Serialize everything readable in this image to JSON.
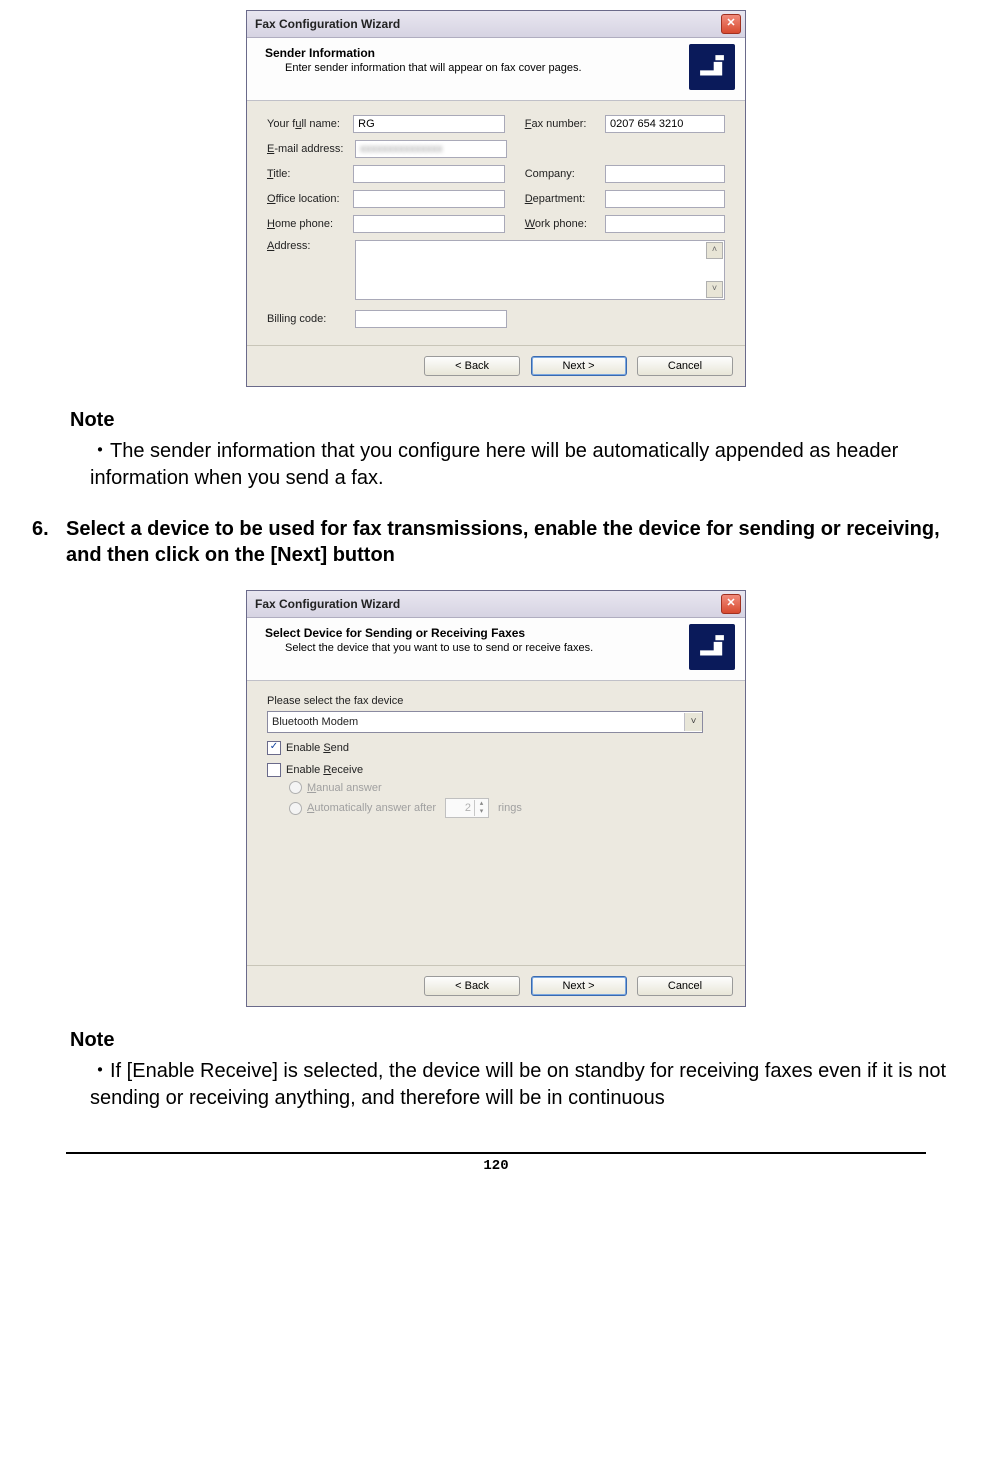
{
  "dialog1": {
    "title": "Fax Configuration Wizard",
    "banner_title": "Sender Information",
    "banner_sub": "Enter sender information that will appear on fax cover pages.",
    "fields": {
      "full_name_label": "Your full name:",
      "full_name_value": "RG",
      "fax_label": "Fax number:",
      "fax_value": "0207 654 3210",
      "email_label": "E-mail address:",
      "email_value": "xxxxxxxxxxxxxxx",
      "title_label": "Title:",
      "company_label": "Company:",
      "office_label": "Office location:",
      "dept_label": "Department:",
      "home_label": "Home phone:",
      "work_label": "Work phone:",
      "address_label": "Address:",
      "billing_label": "Billing code:"
    },
    "buttons": {
      "back": "< Back",
      "next": "Next >",
      "cancel": "Cancel"
    }
  },
  "note1": {
    "heading": "Note",
    "body": "The sender information that you configure here will be automatically appended as header information when you send a fax."
  },
  "step6": {
    "num": "6.",
    "text": "Select a device to be used for fax transmissions, enable the device for sending or receiving, and then click on the [Next] button"
  },
  "dialog2": {
    "title": "Fax Configuration Wizard",
    "banner_title": "Select Device for Sending or Receiving Faxes",
    "banner_sub": "Select the device that you want to use to send or receive faxes.",
    "select_label": "Please select the fax device",
    "select_value": "Bluetooth Modem",
    "enable_send": "Enable Send",
    "enable_receive": "Enable Receive",
    "manual": "Manual answer",
    "auto_prefix": "Automatically answer after",
    "auto_value": "2",
    "auto_suffix": "rings",
    "buttons": {
      "back": "< Back",
      "next": "Next >",
      "cancel": "Cancel"
    }
  },
  "note2": {
    "heading": "Note",
    "body": "If [Enable Receive] is selected, the device will be on standby for receiving faxes even if it is not sending or receiving anything, and therefore will be in continuous"
  },
  "page_number": "120"
}
